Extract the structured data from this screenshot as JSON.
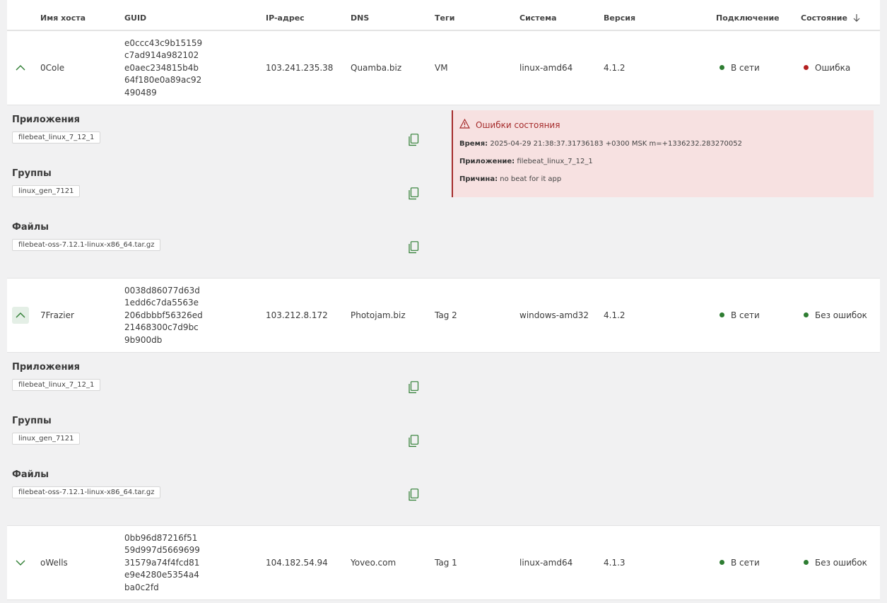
{
  "columns": {
    "hostname": "Имя хоста",
    "guid": "GUID",
    "ip": "IP-адрес",
    "dns": "DNS",
    "tags": "Теги",
    "system": "Система",
    "version": "Версия",
    "connection": "Подключение",
    "state": "Состояние"
  },
  "colors": {
    "online": "#2e7d32",
    "error": "#b42020",
    "accent": "#2e7d32",
    "error_bg": "#f7e1e1"
  },
  "hosts": [
    {
      "expanded": true,
      "hostname": "0Cole",
      "guid": [
        "e0ccc43c9b15159",
        "c7ad914a982102",
        "e0aec234815b4b",
        "64f180e0a89ac92",
        "490489"
      ],
      "ip": "103.241.235.38",
      "dns": "Quamba.biz",
      "tags": "VM",
      "system": "linux-amd64",
      "version": "4.1.2",
      "connection": "В сети",
      "state": "Ошибка"
    },
    {
      "expanded": true,
      "hostname": "7Frazier",
      "guid": [
        "0038d86077d63d",
        "1edd6c7da5563e",
        "206dbbbf56326ed",
        "21468300c7d9bc",
        "9b900db"
      ],
      "ip": "103.212.8.172",
      "dns": "Photojam.biz",
      "tags": "Tag 2",
      "system": "windows-amd32",
      "version": "4.1.2",
      "connection": "В сети",
      "state": "Без ошибок"
    },
    {
      "expanded": false,
      "hostname": "oWells",
      "guid": [
        "0bb96d87216f51",
        "59d997d5669699",
        "31579a74f4fcd81",
        "e9e4280e5354a4",
        "ba0c2fd"
      ],
      "ip": "104.182.54.94",
      "dns": "Yoveo.com",
      "tags": "Tag 1",
      "system": "linux-amd64",
      "version": "4.1.3",
      "connection": "В сети",
      "state": "Без ошибок"
    }
  ],
  "details": [
    {
      "apps_title": "Приложения",
      "app": "filebeat_linux_7_12_1",
      "groups_title": "Группы",
      "group": "linux_gen_7121",
      "files_title": "Файлы",
      "file": "filebeat-oss-7.12.1-linux-x86_64.tar.gz",
      "error": {
        "title": "Ошибки состояния",
        "time_label": "Время:",
        "time": "2025-04-29 21:38:37.31736183 +0300 MSK m=+1336232.283270052",
        "app_label": "Приложение:",
        "app": "filebeat_linux_7_12_1",
        "reason_label": "Причина:",
        "reason": "no beat for it app"
      }
    },
    {
      "apps_title": "Приложения",
      "app": "filebeat_linux_7_12_1",
      "groups_title": "Группы",
      "group": "linux_gen_7121",
      "files_title": "Файлы",
      "file": "filebeat-oss-7.12.1-linux-x86_64.tar.gz"
    }
  ]
}
